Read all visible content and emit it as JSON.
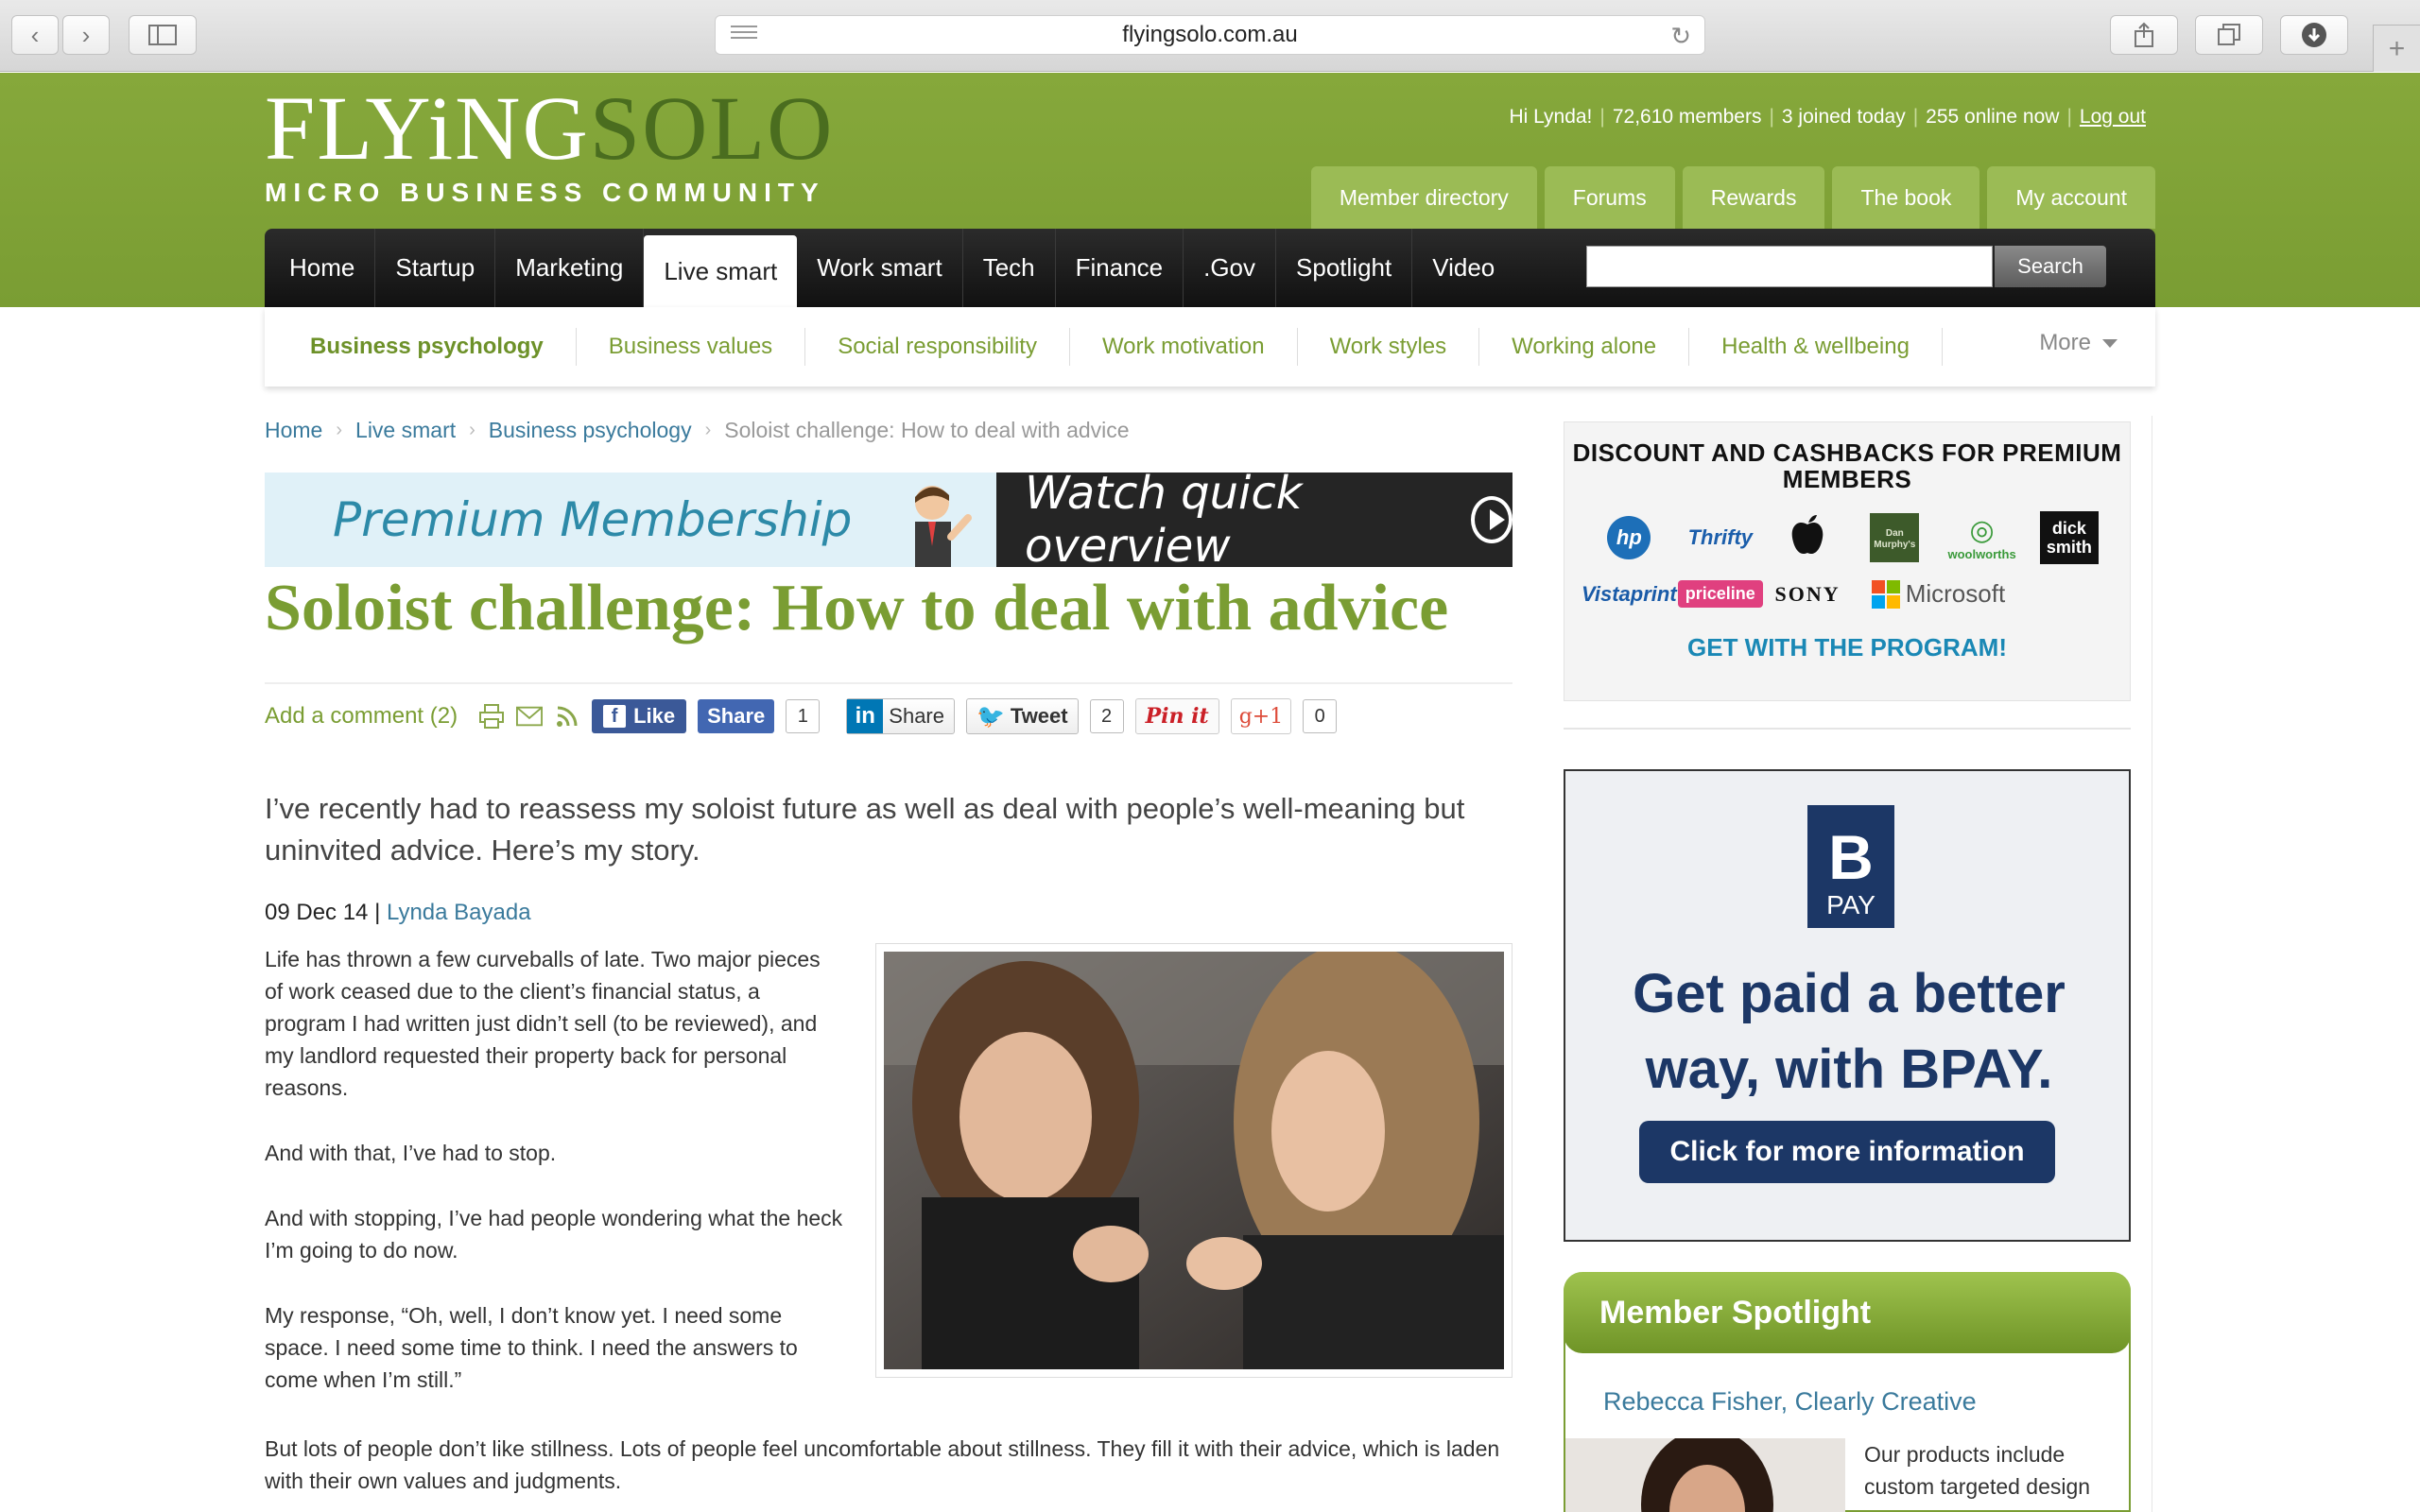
{
  "browser": {
    "url": "flyingsolo.com.au"
  },
  "logo": {
    "word_light": "FLYiNG",
    "word_dark": "SOLO",
    "tagline": "MICRO BUSINESS COMMUNITY"
  },
  "member_info": {
    "greeting": "Hi Lynda!",
    "members": "72,610 members",
    "joined": "3 joined today",
    "online": "255 online now",
    "logout": "Log out"
  },
  "top_tabs": [
    "Member directory",
    "Forums",
    "Rewards",
    "The book",
    "My account"
  ],
  "main_nav": {
    "items": [
      "Home",
      "Startup",
      "Marketing",
      "Live smart",
      "Work smart",
      "Tech",
      "Finance",
      ".Gov",
      "Spotlight",
      "Video"
    ],
    "active": "Live smart",
    "search_button": "Search",
    "search_placeholder": ""
  },
  "sub_nav": {
    "items": [
      "Business psychology",
      "Business values",
      "Social responsibility",
      "Work motivation",
      "Work styles",
      "Working alone",
      "Health & wellbeing"
    ],
    "active": "Business psychology",
    "more": "More"
  },
  "breadcrumb": {
    "items": [
      "Home",
      "Live smart",
      "Business psychology"
    ],
    "current": "Soloist challenge: How to deal with advice"
  },
  "premium_banner": {
    "left_text": "Premium Membership",
    "right_text": "Watch quick overview"
  },
  "article": {
    "title": "Soloist challenge: How to deal with advice",
    "add_comment": "Add a comment (2)",
    "intro": "I’ve recently had to reassess my soloist future as well as deal with people’s well-meaning but uninvited advice. Here’s my story.",
    "date": "09 Dec 14",
    "byline_sep": "|",
    "author": "Lynda Bayada",
    "paragraphs": [
      "Life has thrown a few curveballs of late. Two major pieces of work ceased due to the client’s financial status, a program I had written just didn’t sell (to be reviewed), and my landlord requested their property back for personal reasons.",
      "And with that, I’ve had to stop.",
      "And with stopping, I’ve had people wondering what the heck I’m going to do now.",
      "My response, “Oh, well, I don’t know yet. I need some space. I need some time to think. I need the answers to come when I’m still.”"
    ],
    "wide_paragraph": "But lots of people don’t like stillness. Lots of people feel uncomfortable about stillness. They fill it with their advice, which is laden with their own values and judgments."
  },
  "share": {
    "fb_like": "Like",
    "fb_share": "Share",
    "fb_count": "1",
    "li_label": "Share",
    "li_glyph": "in",
    "tweet": "Tweet",
    "tweet_count": "2",
    "pin": "Pin it",
    "gplus": "g+1",
    "gplus_count": "0"
  },
  "discount_ad": {
    "title": "DISCOUNT AND CASHBACKS FOR PREMIUM MEMBERS",
    "brands": [
      {
        "name": "hp",
        "color": "#1d6fb8"
      },
      {
        "name": "Thrifty",
        "color": "#1b5eab"
      },
      {
        "name": "",
        "color": "#111"
      },
      {
        "name": "Dan Murphy's",
        "color": "#3d5a2a"
      },
      {
        "name": "woolworths",
        "color": "#3a9a3a"
      },
      {
        "name": "dick smith",
        "color": "#ffffff"
      },
      {
        "name": "Vistaprint",
        "color": "#1a5ba8"
      },
      {
        "name": "priceline",
        "color": "#e0407f"
      },
      {
        "name": "SONY",
        "color": "#111"
      },
      {
        "name": "Microsoft",
        "color": "#555"
      }
    ],
    "cta": "GET WITH THE PROGRAM!"
  },
  "bpay_ad": {
    "logo_letter": "B",
    "logo_pay": "PAY",
    "headline_line1": "Get paid a better",
    "headline_line2": "way, with BPAY.",
    "button": "Click for more information"
  },
  "spotlight": {
    "heading": "Member Spotlight",
    "name": "Rebecca Fisher, Clearly Creative",
    "text": "Our products include custom targeted design"
  },
  "colors": {
    "brand_green": "#7a9d33",
    "link_blue": "#3a7a9c",
    "bpay_navy": "#1c3766"
  }
}
